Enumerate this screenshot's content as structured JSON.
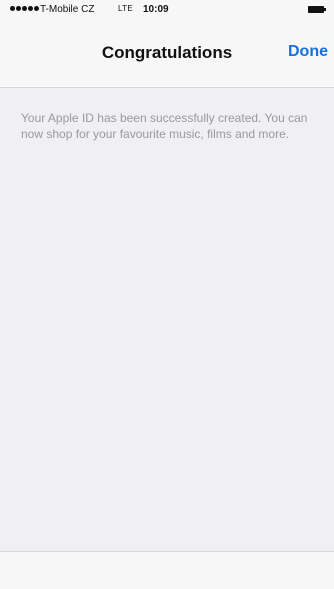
{
  "status_bar": {
    "carrier": "T-Mobile CZ",
    "network": "LTE",
    "time": "10:09",
    "signal_bars": 5
  },
  "nav": {
    "title": "Congratulations",
    "done_label": "Done"
  },
  "main": {
    "message": "Your Apple ID has been successfully created. You can now shop for your favourite music, films and more."
  },
  "colors": {
    "accent": "#1a6fe0",
    "background": "#efeff4",
    "bar": "#f7f7f8",
    "message_text": "#9a9a9e"
  }
}
